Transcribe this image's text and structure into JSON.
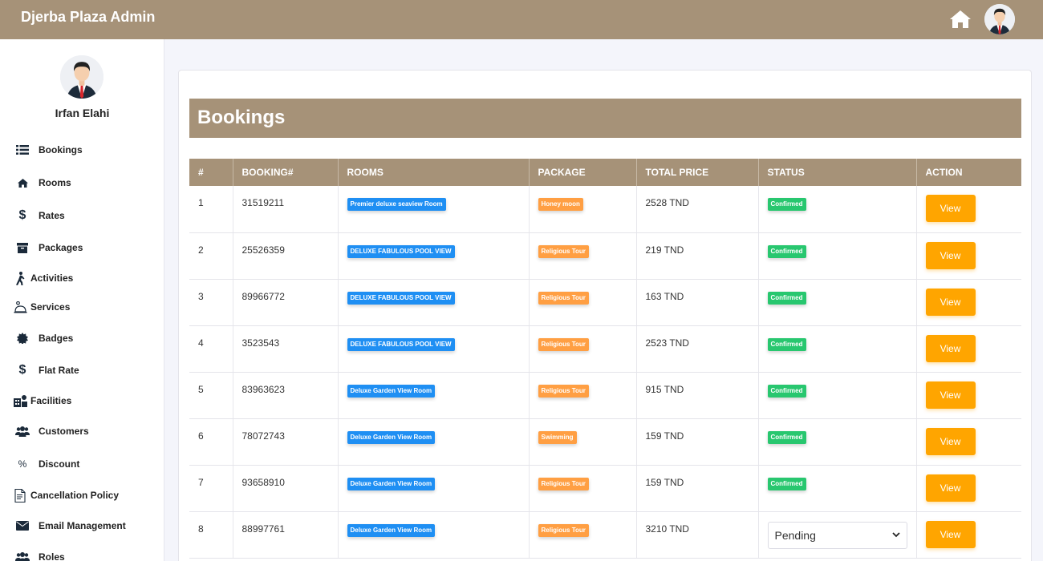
{
  "app": {
    "title": "Djerba Plaza Admin"
  },
  "colors": {
    "brand": "#a69278",
    "accent": "#ffa500",
    "room_badge": "#1f8ff3",
    "package_badge": "#ff9f43",
    "status_badge": "#28c76f"
  },
  "header": {
    "home_icon": "home-icon",
    "avatar_icon": "user-avatar-icon"
  },
  "sidebar": {
    "user_name": "Irfan Elahi",
    "items": [
      {
        "label": "Bookings",
        "icon": "list-icon"
      },
      {
        "label": "Rooms",
        "icon": "home-icon"
      },
      {
        "label": "Rates",
        "icon": "dollar-icon"
      },
      {
        "label": "Packages",
        "icon": "archive-icon"
      },
      {
        "label": "Activities",
        "icon": "walking-icon"
      },
      {
        "label": "Services",
        "icon": "concierge-bell-icon"
      },
      {
        "label": "Badges",
        "icon": "certificate-icon"
      },
      {
        "label": "Flat Rate",
        "icon": "dollar-icon"
      },
      {
        "label": "Facilities",
        "icon": "facilities-icon"
      },
      {
        "label": "Customers",
        "icon": "users-icon"
      },
      {
        "label": "Discount",
        "icon": "percent-icon"
      },
      {
        "label": "Cancellation Policy",
        "icon": "document-icon"
      },
      {
        "label": "Email Management",
        "icon": "envelope-icon"
      },
      {
        "label": "Roles",
        "icon": "users-icon"
      }
    ]
  },
  "main": {
    "title": "Bookings",
    "columns": [
      "#",
      "BOOKING#",
      "ROOMS",
      "PACKAGE",
      "TOTAL PRICE",
      "STATUS",
      "ACTION"
    ],
    "rows": [
      {
        "num": "1",
        "booking": "31519211",
        "room": "Premier deluxe seaview Room",
        "package": "Honey moon",
        "price": "2528 TND",
        "status": "Confirmed",
        "action": "View"
      },
      {
        "num": "2",
        "booking": "25526359",
        "room": "DELUXE FABULOUS POOL VIEW",
        "package": "Religious Tour",
        "price": "219 TND",
        "status": "Confirmed",
        "action": "View"
      },
      {
        "num": "3",
        "booking": "89966772",
        "room": "DELUXE FABULOUS POOL VIEW",
        "package": "Religious Tour",
        "price": "163 TND",
        "status": "Confirmed",
        "action": "View"
      },
      {
        "num": "4",
        "booking": "3523543",
        "room": "DELUXE FABULOUS POOL VIEW",
        "package": "Religious Tour",
        "price": "2523 TND",
        "status": "Confirmed",
        "action": "View"
      },
      {
        "num": "5",
        "booking": "83963623",
        "room": "Deluxe Garden View Room",
        "package": "Religious Tour",
        "price": "915 TND",
        "status": "Confirmed",
        "action": "View"
      },
      {
        "num": "6",
        "booking": "78072743",
        "room": "Deluxe Garden View Room",
        "package": "Swimming",
        "price": "159 TND",
        "status": "Confirmed",
        "action": "View"
      },
      {
        "num": "7",
        "booking": "93658910",
        "room": "Deluxe Garden View Room",
        "package": "Religious Tour",
        "price": "159 TND",
        "status": "Confirmed",
        "action": "View"
      },
      {
        "num": "8",
        "booking": "88997761",
        "room": "Deluxe Garden View Room",
        "package": "Religious Tour",
        "price": "3210 TND",
        "status_select": "Pending",
        "action": "View"
      }
    ]
  }
}
